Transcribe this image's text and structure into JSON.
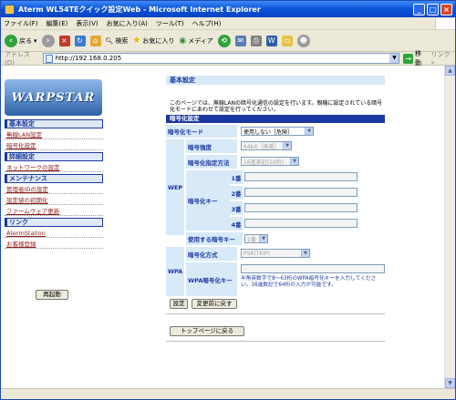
{
  "window": {
    "title": "Aterm WL54TEクイック設定Web - Microsoft Internet Explorer"
  },
  "menu": [
    "ファイル(F)",
    "編集(E)",
    "表示(V)",
    "お気に入り(A)",
    "ツール(T)",
    "ヘルプ(H)"
  ],
  "toolbar": {
    "back": "戻る",
    "search": "検索",
    "favorites": "お気に入り",
    "media": "メディア"
  },
  "address": {
    "label": "アドレス(D)",
    "url": "http://192.168.0.205",
    "go": "移動",
    "links": "リンク »"
  },
  "logo": "WARPSTAR",
  "nav": [
    {
      "type": "cat",
      "label": "基本設定"
    },
    {
      "type": "item",
      "label": "無線LAN設定"
    },
    {
      "type": "item",
      "label": "暗号化設定"
    },
    {
      "type": "cat",
      "label": "詳細設定"
    },
    {
      "type": "item",
      "label": "ネットワークの設定"
    },
    {
      "type": "cat",
      "label": "メンテナンス"
    },
    {
      "type": "item",
      "label": "管理者IDの設定"
    },
    {
      "type": "item",
      "label": "設定値の初期化"
    },
    {
      "type": "item",
      "label": "ファームウェア更新"
    },
    {
      "type": "cat",
      "label": "リンク"
    },
    {
      "type": "item",
      "label": "AtermStation"
    },
    {
      "type": "item",
      "label": "お客様登録"
    }
  ],
  "restart_button": "再起動",
  "main": {
    "header": "基本設定",
    "description": "このページでは、無線LANの暗号化通信の設定を行います。親機に設定されている暗号化モードにあわせて設定を行ってください。",
    "section": "暗号化設定",
    "mode_label": "暗号化モード",
    "mode_value": "使用しない［危険］",
    "wep_label": "WEP",
    "strength_label": "暗号強度",
    "strength_value": "64bit［推奨］",
    "method_label": "暗号化指定方法",
    "method_value": "16進表記(10桁)",
    "key_label": "暗号化キー",
    "keys": [
      "1番",
      "2番",
      "3番",
      "4番"
    ],
    "use_key_label": "使用する暗号キー",
    "use_key_value": "1番",
    "wpa_label": "WPA",
    "wpa_method_label": "暗号化方式",
    "wpa_method_value": "PSK(TKIP)",
    "wpa_key_label": "WPA暗号化キー",
    "wpa_note": "半角英数字で8～63桁のWPA暗号化キーを入力してください。16進数記で64桁の入力が可能です。",
    "set_button": "設定",
    "revert_button": "変更前に戻す",
    "top_button": "トップページに戻る"
  }
}
